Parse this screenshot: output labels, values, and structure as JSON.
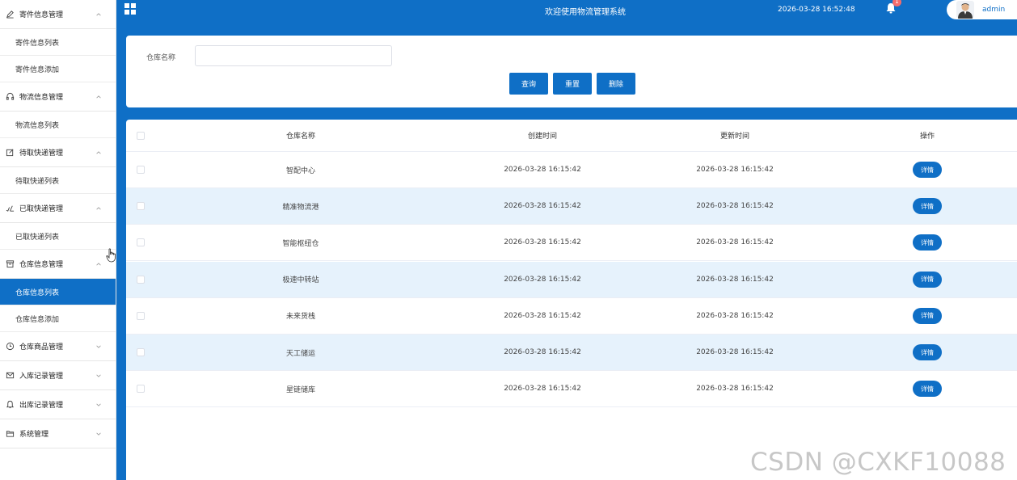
{
  "sidebar": {
    "groups": [
      {
        "label": "寄件信息管理",
        "icon": "pen-icon",
        "expanded": true,
        "items": [
          "寄件信息列表",
          "寄件信息添加"
        ]
      },
      {
        "label": "物流信息管理",
        "icon": "headphones-icon",
        "expanded": true,
        "items": [
          "物流信息列表"
        ]
      },
      {
        "label": "待取快递管理",
        "icon": "edit-box-icon",
        "expanded": true,
        "items": [
          "待取快递列表"
        ]
      },
      {
        "label": "已取快递管理",
        "icon": "signature-icon",
        "expanded": true,
        "items": [
          "已取快递列表"
        ]
      },
      {
        "label": "仓库信息管理",
        "icon": "archive-box-icon",
        "expanded": true,
        "items": [
          "仓库信息列表",
          "仓库信息添加"
        ],
        "active_item": "仓库信息列表"
      },
      {
        "label": "仓库商品管理",
        "icon": "clock-icon",
        "expanded": false,
        "items": []
      },
      {
        "label": "入库记录管理",
        "icon": "mail-icon",
        "expanded": false,
        "items": []
      },
      {
        "label": "出库记录管理",
        "icon": "bell-icon",
        "expanded": false,
        "items": []
      },
      {
        "label": "系统管理",
        "icon": "folder-icon",
        "expanded": false,
        "items": []
      }
    ]
  },
  "header": {
    "title": "欢迎使用物流管理系统",
    "datetime": "2026-03-28 16:52:48",
    "notification_badge": "1",
    "username": "admin"
  },
  "search": {
    "label": "仓库名称",
    "value": "",
    "buttons": {
      "query": "查询",
      "reset": "重置",
      "delete": "删除"
    }
  },
  "table": {
    "columns": {
      "name": "仓库名称",
      "created": "创建时间",
      "updated": "更新时间",
      "op": "操作"
    },
    "detail_label": "详情",
    "rows": [
      {
        "name": "智配中心",
        "created": "2026-03-28 16:15:42",
        "updated": "2026-03-28 16:15:42"
      },
      {
        "name": "精准物流港",
        "created": "2026-03-28 16:15:42",
        "updated": "2026-03-28 16:15:42"
      },
      {
        "name": "智能枢纽仓",
        "created": "2026-03-28 16:15:42",
        "updated": "2026-03-28 16:15:42"
      },
      {
        "name": "极速中转站",
        "created": "2026-03-28 16:15:42",
        "updated": "2026-03-28 16:15:42"
      },
      {
        "name": "未来货栈",
        "created": "2026-03-28 16:15:42",
        "updated": "2026-03-28 16:15:42"
      },
      {
        "name": "天工储运",
        "created": "2026-03-28 16:15:42",
        "updated": "2026-03-28 16:15:42"
      },
      {
        "name": "星链储库",
        "created": "2026-03-28 16:15:42",
        "updated": "2026-03-28 16:15:42"
      }
    ]
  },
  "watermark": "CSDN @CXKF10088",
  "colors": {
    "primary": "#0f6fc6",
    "row_alt": "#e6f2fc",
    "badge": "#f56c6c"
  }
}
